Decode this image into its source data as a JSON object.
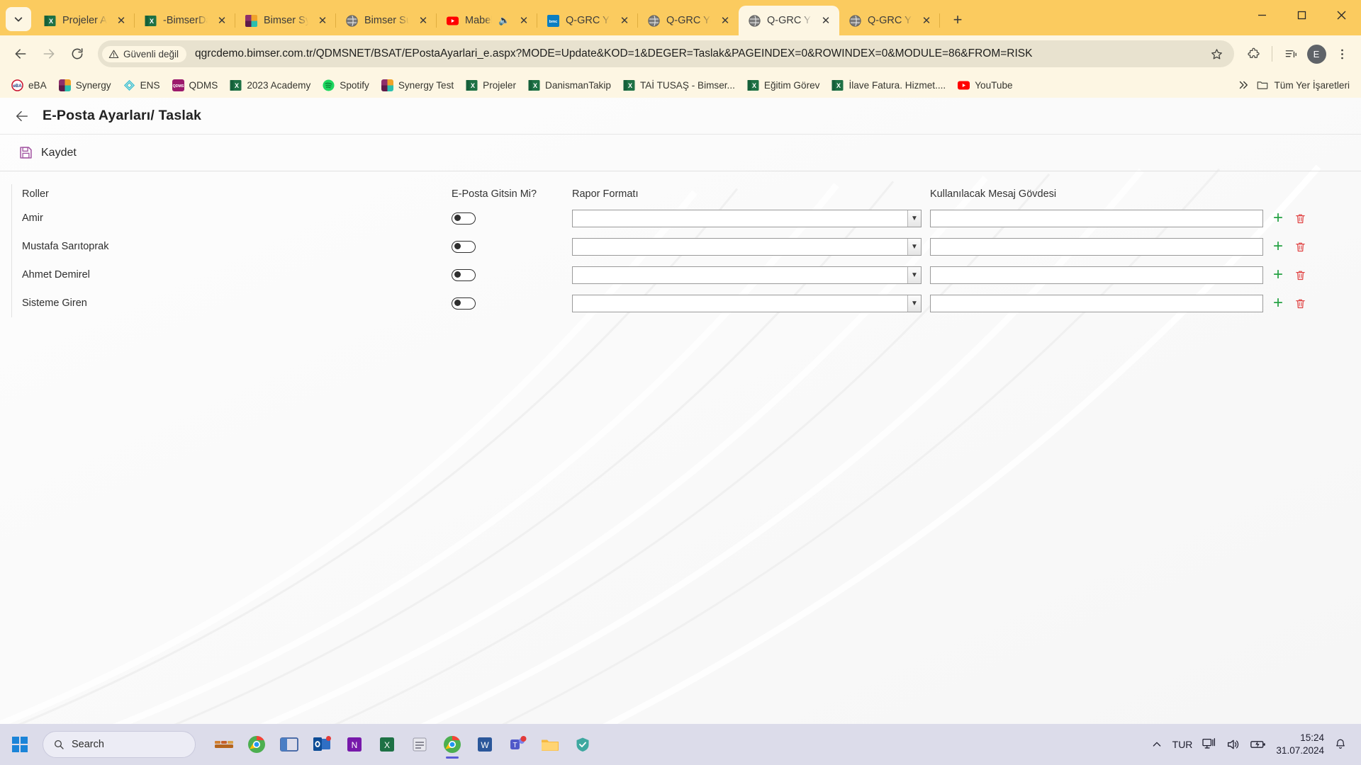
{
  "browser": {
    "tab_search_icon": "chevron-down-icon",
    "tabs": [
      {
        "title": "Projeler Appli",
        "favicon": "excel-icon",
        "fav_color": "#1e7145",
        "active": false,
        "audio": false
      },
      {
        "title": "-BimserDanis",
        "favicon": "excel-icon",
        "fav_color": "#1e7145",
        "active": false,
        "audio": false
      },
      {
        "title": "Bimser Synerg",
        "favicon": "synergy-icon",
        "fav_color": "#8e2f6b",
        "active": false,
        "audio": false
      },
      {
        "title": "Bimser Suppo",
        "favicon": "globe-icon",
        "fav_color": "#6d6d6d",
        "active": false,
        "audio": false
      },
      {
        "title": "Mabel Ma",
        "favicon": "youtube-icon",
        "fav_color": "#ff0000",
        "active": false,
        "audio": true
      },
      {
        "title": "Q-GRC Yöneti",
        "favicon": "bimser-icon",
        "fav_color": "#0a7ec2",
        "active": false,
        "audio": false
      },
      {
        "title": "Q-GRC Yöneti",
        "favicon": "globe-icon",
        "fav_color": "#6d6d6d",
        "active": false,
        "audio": false
      },
      {
        "title": "Q-GRC Yöneti",
        "favicon": "globe-icon",
        "fav_color": "#6d6d6d",
        "active": true,
        "audio": false
      },
      {
        "title": "Q-GRC Yöneti",
        "favicon": "globe-icon",
        "fav_color": "#6d6d6d",
        "active": false,
        "audio": false
      }
    ],
    "new_tab_label": "+",
    "window_controls": {
      "minimize": "–",
      "maximize": "□",
      "close": "✕"
    },
    "toolbar": {
      "back_icon": "arrow-left-icon",
      "forward_icon": "arrow-right-icon",
      "reload_icon": "reload-icon",
      "security_label": "Güvenli değil",
      "security_icon": "warning-triangle-icon",
      "url": "qgrcdemo.bimser.com.tr/QDMSNET/BSAT/EPostaAyarlari_e.aspx?MODE=Update&KOD=1&DEGER=Taslak&PAGEINDEX=0&ROWINDEX=0&MODULE=86&FROM=RISK",
      "bookmark_icon": "star-icon",
      "extensions_icon": "puzzle-icon",
      "media_icon": "media-control-icon",
      "profile_initial": "E",
      "menu_icon": "three-dot-menu-icon"
    },
    "bookmarks": [
      {
        "label": "eBA",
        "icon": "eba-icon",
        "color": "#c8102e"
      },
      {
        "label": "Synergy",
        "icon": "synergy-icon",
        "color": "#8e2f6b"
      },
      {
        "label": "ENS",
        "icon": "ens-icon",
        "color": "#3fc1d4"
      },
      {
        "label": "QDMS",
        "icon": "qdms-icon",
        "color": "#9c1a6c"
      },
      {
        "label": "2023 Academy",
        "icon": "excel-icon",
        "color": "#1e7145"
      },
      {
        "label": "Spotify",
        "icon": "spotify-icon",
        "color": "#1ed760"
      },
      {
        "label": "Synergy Test",
        "icon": "synergy-icon",
        "color": "#8e2f6b"
      },
      {
        "label": "Projeler",
        "icon": "excel-icon",
        "color": "#1e7145"
      },
      {
        "label": "DanismanTakip",
        "icon": "excel-icon",
        "color": "#1e7145"
      },
      {
        "label": "TAİ TUSAŞ - Bimser...",
        "icon": "excel-icon",
        "color": "#1e7145"
      },
      {
        "label": "Eğitim Görev",
        "icon": "excel-icon",
        "color": "#1e7145"
      },
      {
        "label": "İlave Fatura. Hizmet....",
        "icon": "excel-icon",
        "color": "#1e7145"
      },
      {
        "label": "YouTube",
        "icon": "youtube-icon",
        "color": "#ff0000"
      }
    ],
    "bookmarks_overflow_icon": "double-chevron-right-icon",
    "all_bookmarks_label": "Tüm Yer İşaretleri",
    "all_bookmarks_icon": "folder-icon"
  },
  "page": {
    "back_icon": "arrow-left-icon",
    "title": "E-Posta Ayarları/ Taslak",
    "save_label": "Kaydet",
    "save_icon": "floppy-disk-icon",
    "columns": {
      "role": "Roller",
      "email": "E-Posta Gitsin Mi?",
      "format": "Rapor Formatı",
      "body": "Kullanılacak Mesaj Gövdesi"
    },
    "rows": [
      {
        "role": "Amir",
        "email_toggle": false,
        "format": "",
        "body": "",
        "add_icon": "plus-icon",
        "delete_icon": "trash-icon"
      },
      {
        "role": "Mustafa Sarıtoprak",
        "email_toggle": false,
        "format": "",
        "body": "",
        "add_icon": "plus-icon",
        "delete_icon": "trash-icon"
      },
      {
        "role": "Ahmet Demirel",
        "email_toggle": false,
        "format": "",
        "body": "",
        "add_icon": "plus-icon",
        "delete_icon": "trash-icon"
      },
      {
        "role": "Sisteme Giren",
        "email_toggle": false,
        "format": "",
        "body": "",
        "add_icon": "plus-icon",
        "delete_icon": "trash-icon"
      }
    ]
  },
  "taskbar": {
    "start_icon": "windows-start-icon",
    "search_placeholder": "Search",
    "search_icon": "search-icon",
    "apps": [
      {
        "name": "widgets-icon"
      },
      {
        "name": "chrome-icon"
      },
      {
        "name": "task-view-icon"
      },
      {
        "name": "outlook-icon"
      },
      {
        "name": "onenote-icon"
      },
      {
        "name": "excel-icon"
      },
      {
        "name": "notepad-icon"
      },
      {
        "name": "chrome-active-icon"
      },
      {
        "name": "word-icon"
      },
      {
        "name": "teams-icon"
      },
      {
        "name": "file-explorer-icon"
      },
      {
        "name": "security-icon"
      }
    ],
    "tray": {
      "overflow_icon": "chevron-up-icon",
      "language": "TUR",
      "network_icon": "network-icon",
      "volume_icon": "volume-icon",
      "battery_icon": "battery-icon",
      "time": "15:24",
      "date": "31.07.2024",
      "notification_icon": "bell-icon"
    }
  },
  "colors": {
    "chrome_theme": "#fbcb5f",
    "chrome_surface": "#fdf6e3",
    "accent_green": "#25a244",
    "accent_red": "#e04444",
    "save_purple": "#a0509f"
  }
}
